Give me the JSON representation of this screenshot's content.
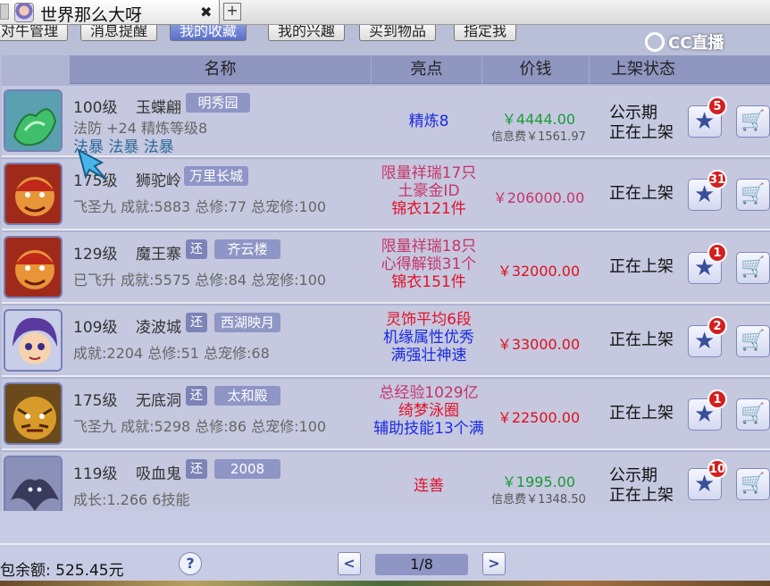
{
  "window": {
    "tab_title": "世界那么大呀",
    "close_glyph": "✖",
    "add_glyph": "+"
  },
  "watermark": {
    "text": "CC直播"
  },
  "filters": [
    {
      "label": "对牛管理",
      "active": false
    },
    {
      "label": "消息提醒",
      "active": false
    },
    {
      "label": "我的收藏",
      "active": true
    },
    {
      "label": "我的兴趣",
      "active": false
    },
    {
      "label": "买到物品",
      "active": false
    },
    {
      "label": "指定我",
      "active": false
    }
  ],
  "table": {
    "headers": {
      "name": "名称",
      "highlight": "亮点",
      "price": "价钱",
      "status": "上架状态"
    },
    "rows": [
      {
        "level": "100级",
        "name": "玉蝶翩",
        "tag": "",
        "server": "明秀园",
        "line2": "法防 +24 精炼等级8",
        "line3": "法暴 法暴 法暴",
        "highlights": [
          {
            "text": "精炼8",
            "color": "blue"
          }
        ],
        "price": "￥4444.00",
        "price_color": "green",
        "fee": "信息费￥1561.97",
        "status": [
          "公示期",
          "正在上架"
        ],
        "fav_count": "5",
        "avatar": "jade-artifact"
      },
      {
        "level": "175级",
        "name": "狮驼岭",
        "tag": "",
        "server": "万里长城",
        "line2": "飞圣九  成就:5883  总修:77  总宠修:100",
        "line3": "",
        "highlights": [
          {
            "text": "限量祥瑞17只",
            "color": "pink"
          },
          {
            "text": "土豪金ID",
            "color": "pink"
          },
          {
            "text": "锦衣121件",
            "color": "sred"
          }
        ],
        "price": "￥206000.00",
        "price_color": "pink",
        "fee": "",
        "status": [
          "正在上架"
        ],
        "fav_count": "31",
        "avatar": "lion-demon"
      },
      {
        "level": "129级",
        "name": "魔王寨",
        "tag": "还",
        "server": "齐云楼",
        "line2": "已飞升  成就:5575  总修:84  总宠修:100",
        "line3": "",
        "highlights": [
          {
            "text": "限量祥瑞18只",
            "color": "pink"
          },
          {
            "text": "心得解锁31个",
            "color": "pink"
          },
          {
            "text": "锦衣151件",
            "color": "sred"
          }
        ],
        "price": "￥32000.00",
        "price_color": "red",
        "fee": "",
        "status": [
          "正在上架"
        ],
        "fav_count": "1",
        "avatar": "demon-king"
      },
      {
        "level": "109级",
        "name": "凌波城",
        "tag": "还",
        "server": "西湖映月",
        "line2": "成就:2204  总修:51  总宠修:68",
        "line3": "",
        "highlights": [
          {
            "text": "灵饰平均6段",
            "color": "sred"
          },
          {
            "text": "机缘属性优秀",
            "color": "blue"
          },
          {
            "text": "满强壮神速",
            "color": "blue"
          }
        ],
        "price": "￥33000.00",
        "price_color": "red",
        "fee": "",
        "status": [
          "正在上架"
        ],
        "fav_count": "2",
        "avatar": "purple-hair-boy"
      },
      {
        "level": "175级",
        "name": "无底洞",
        "tag": "还",
        "server": "太和殿",
        "line2": "飞圣九  成就:5298  总修:86  总宠修:100",
        "line3": "",
        "highlights": [
          {
            "text": "总经验1029亿",
            "color": "pink"
          },
          {
            "text": "绮梦泳圈",
            "color": "sred"
          },
          {
            "text": "辅助技能13个满",
            "color": "blue"
          }
        ],
        "price": "￥22500.00",
        "price_color": "red",
        "fee": "",
        "status": [
          "正在上架"
        ],
        "fav_count": "1",
        "avatar": "tiger-mask"
      },
      {
        "level": "119级",
        "name": "吸血鬼",
        "tag": "还",
        "server": "2008",
        "line2": "成长:1.266  6技能",
        "line3": "",
        "highlights": [
          {
            "text": "连善",
            "color": "sred"
          }
        ],
        "price": "￥1995.00",
        "price_color": "green",
        "fee": "信息费￥1348.50",
        "status": [
          "公示期",
          "正在上架"
        ],
        "fav_count": "10",
        "avatar": "vampire-pet"
      }
    ]
  },
  "footer": {
    "balance": "包余额: 525.45元",
    "help_glyph": "?",
    "prev_glyph": "<",
    "next_glyph": ">",
    "page": "1/8"
  },
  "colors": {
    "green": "#1a9a3a",
    "red": "#e0101a",
    "pink": "#c8336a",
    "blue": "#1a2ae0",
    "sred": "#e4102a"
  }
}
